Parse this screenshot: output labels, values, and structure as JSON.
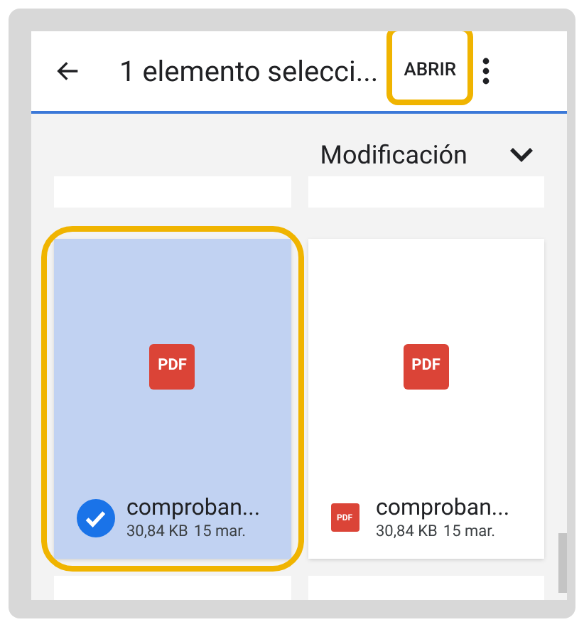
{
  "app_bar": {
    "title": "1 elemento selecci...",
    "action": "ABRIR"
  },
  "sort_bar": {
    "label": "Modificación"
  },
  "files": [
    {
      "name": "comproban...",
      "size": "30,84 KB",
      "date": "15 mar.",
      "icon_label": "PDF",
      "selected": true
    },
    {
      "name": "comproban...",
      "size": "30,84 KB",
      "date": "15 mar.",
      "icon_label": "PDF",
      "badge_label": "PDF",
      "selected": false
    }
  ]
}
